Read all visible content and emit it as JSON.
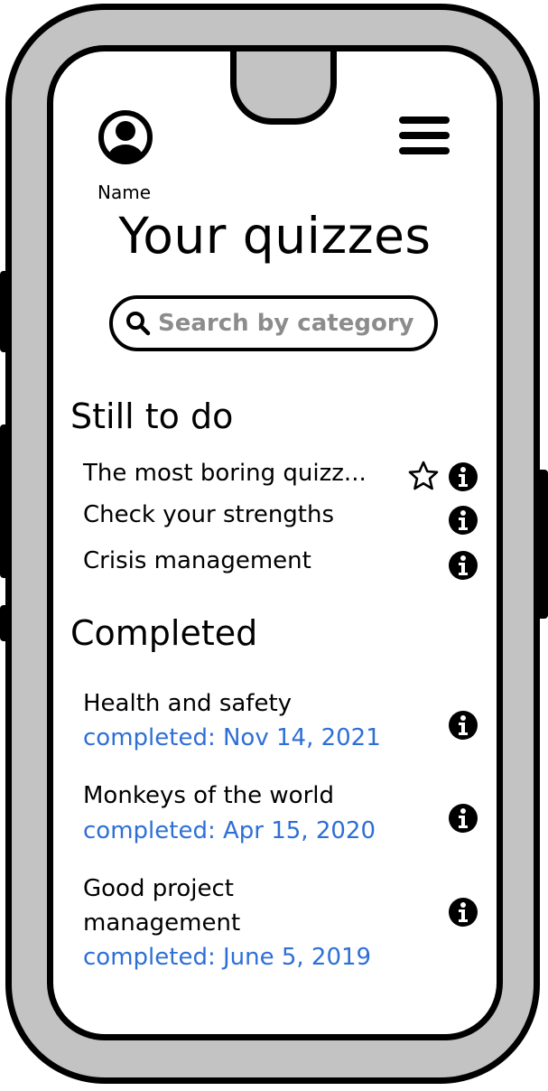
{
  "header": {
    "user_name": "Name",
    "avatar_icon": "user-avatar-icon",
    "menu_icon": "hamburger-menu-icon"
  },
  "page_title": "Your quizzes",
  "search": {
    "placeholder": "Search by category",
    "icon": "search-icon"
  },
  "sections": {
    "todo_title": "Still to do",
    "completed_title": "Completed"
  },
  "todo": [
    {
      "title": "The most boring quizz...",
      "starred": false
    },
    {
      "title": "Check your strengths"
    },
    {
      "title": "Crisis management"
    }
  ],
  "completed": [
    {
      "title": "Health and safety",
      "date": "completed: Nov 14, 2021"
    },
    {
      "title": "Monkeys of the world",
      "date": "completed: Apr 15, 2020"
    },
    {
      "title_line1": "Good project",
      "title_line2": "management",
      "date": "completed: June 5, 2019"
    }
  ],
  "colors": {
    "frame": "#c3c3c3",
    "date_text": "#2e6fd6",
    "placeholder_text": "#8c8c8c"
  }
}
